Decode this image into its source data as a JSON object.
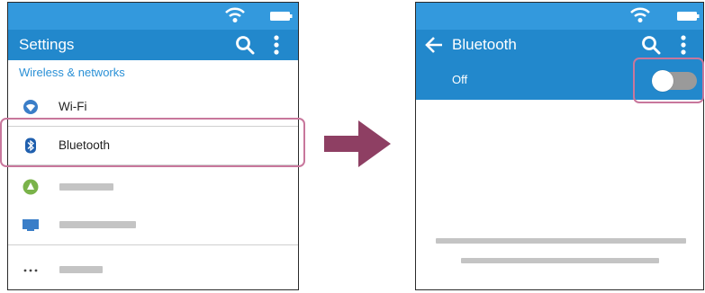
{
  "left_screen": {
    "app_bar": {
      "title": "Settings"
    },
    "section_header": "Wireless & networks",
    "items": [
      {
        "label": "Wi-Fi",
        "icon": "wifi-icon"
      },
      {
        "label": "Bluetooth",
        "icon": "bluetooth-icon"
      },
      {
        "label": "",
        "icon": "data-usage-icon"
      },
      {
        "label": "",
        "icon": "display-icon"
      },
      {
        "label": "",
        "icon": "more-dots-icon"
      }
    ]
  },
  "right_screen": {
    "app_bar": {
      "title": "Bluetooth"
    },
    "toggle": {
      "label": "Off",
      "state": "off"
    }
  },
  "colors": {
    "status_bar": "#3399dd",
    "app_bar": "#2288cc",
    "highlight": "#c8779c",
    "arrow": "#8e3f63"
  }
}
